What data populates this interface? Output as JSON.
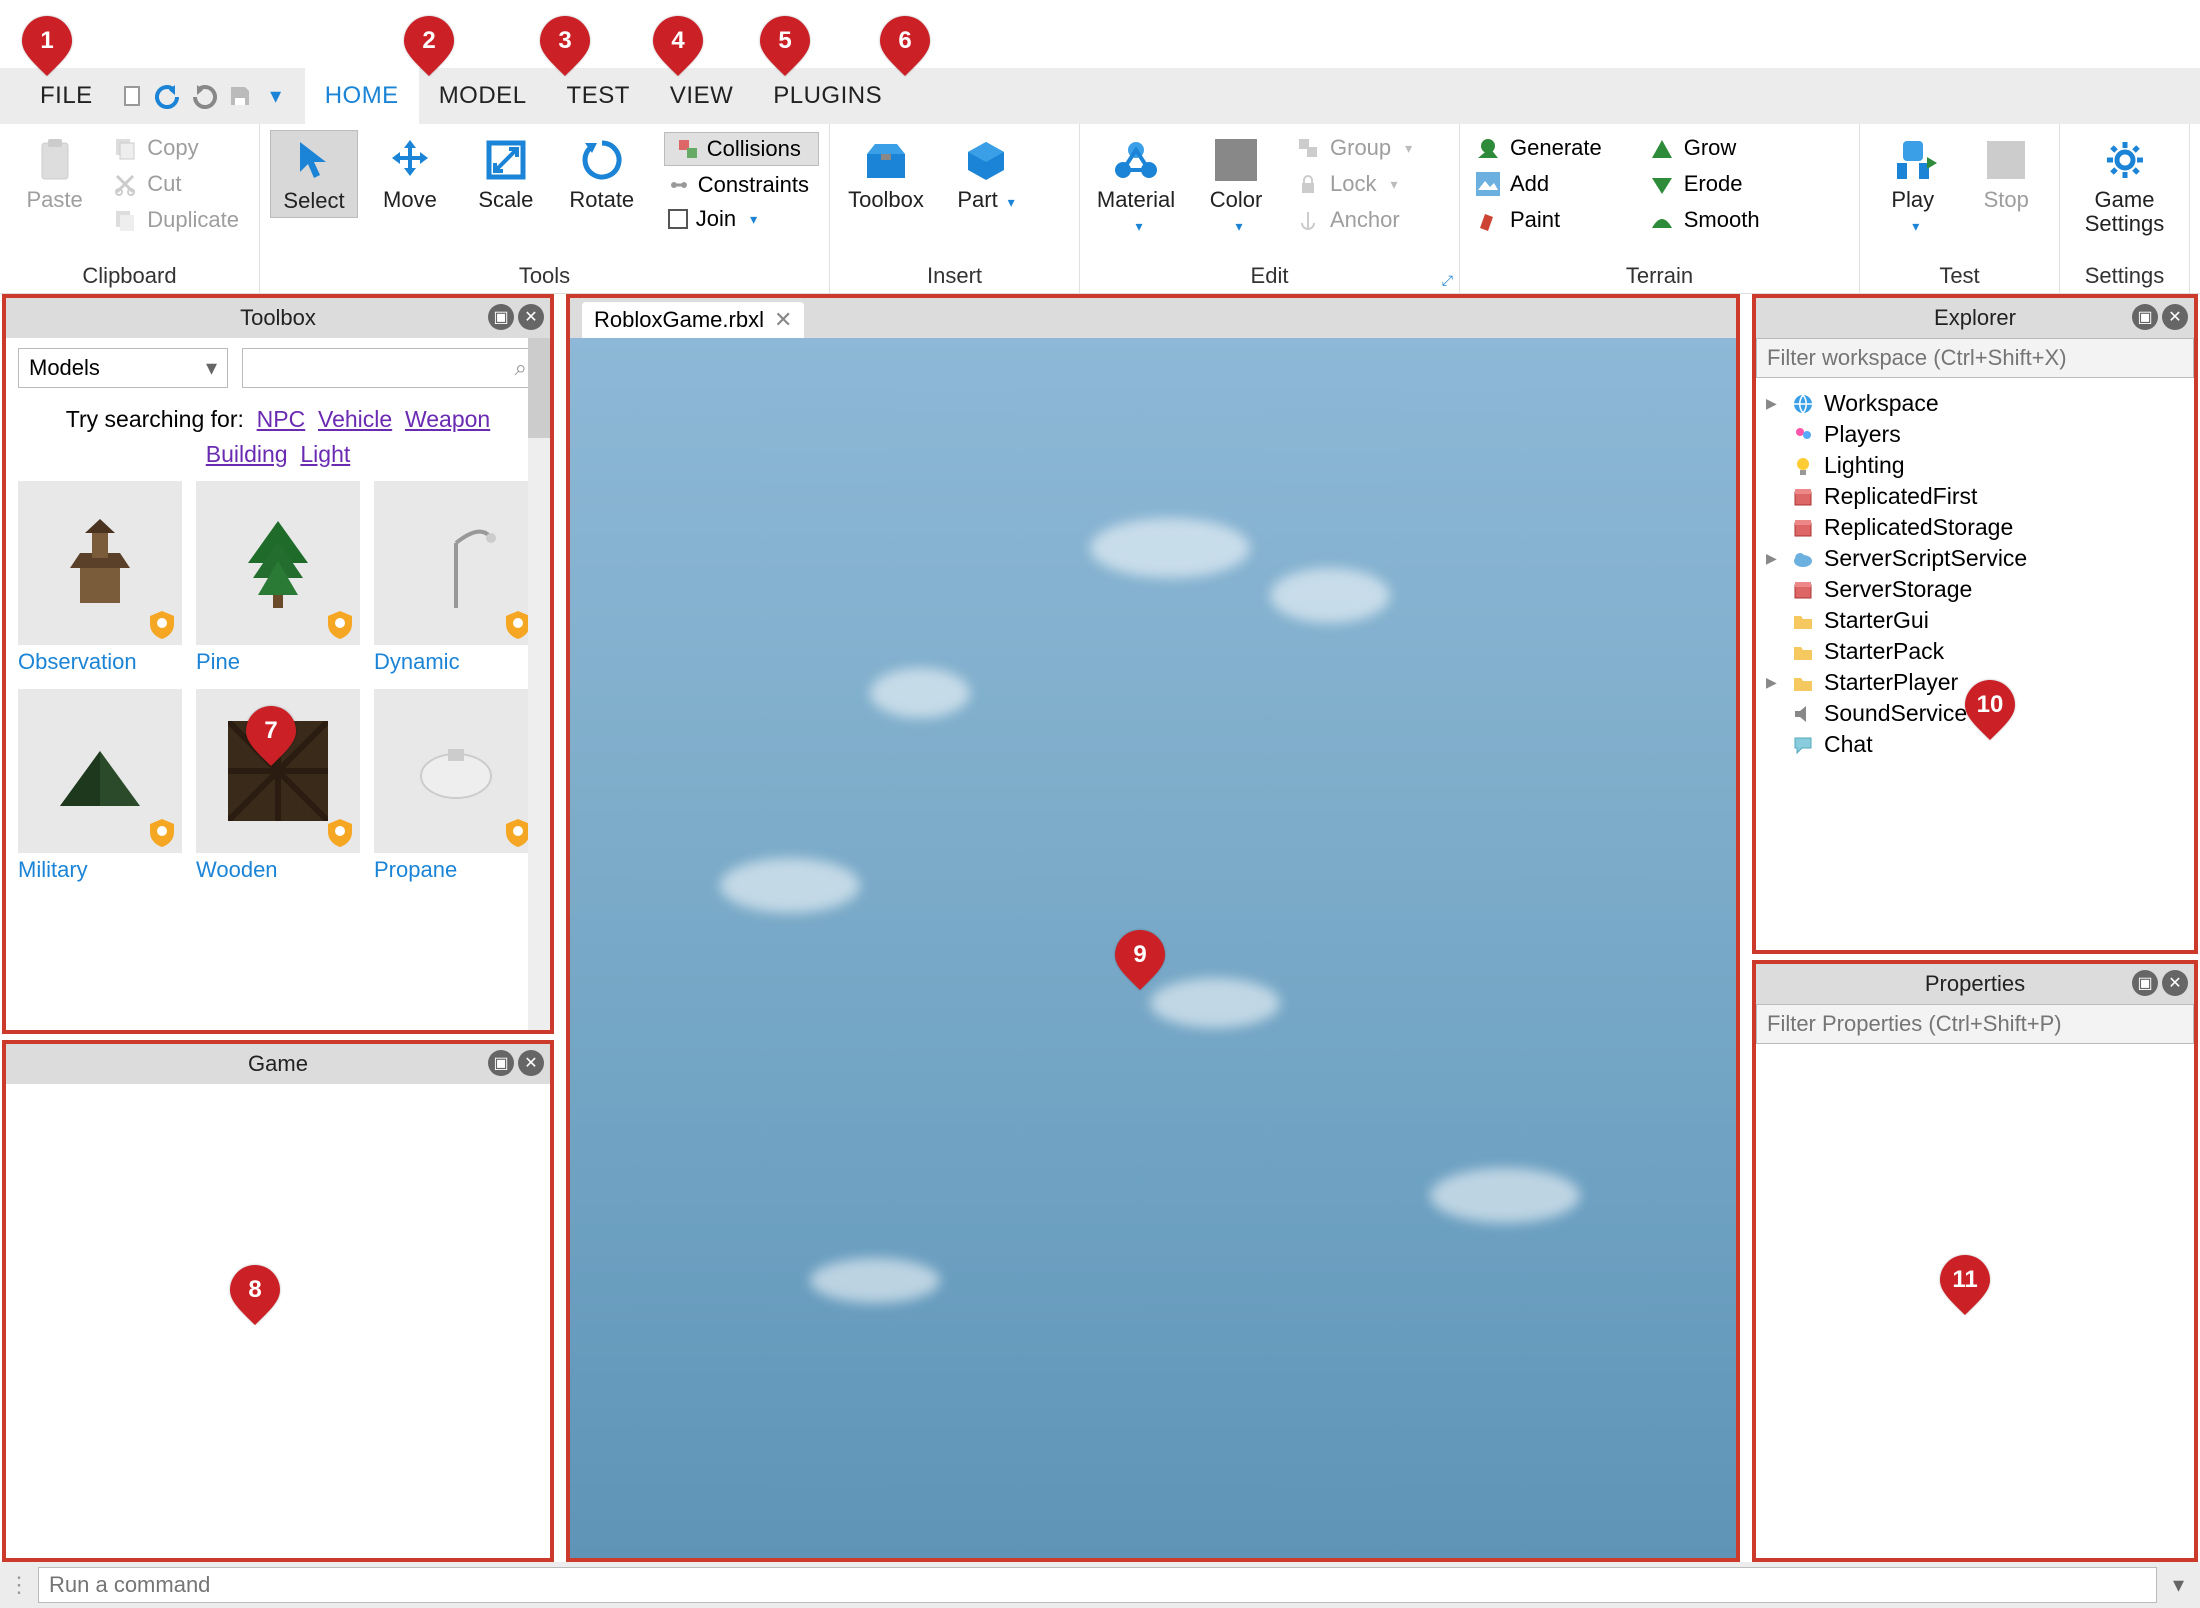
{
  "menubar": {
    "items": [
      "FILE",
      "HOME",
      "MODEL",
      "TEST",
      "VIEW",
      "PLUGINS"
    ],
    "active_index": 1,
    "qa": [
      "new-file-icon",
      "undo-icon",
      "redo-icon",
      "save-icon",
      "menu-icon"
    ]
  },
  "ribbon": {
    "clipboard": {
      "label": "Clipboard",
      "paste": "Paste",
      "copy": "Copy",
      "cut": "Cut",
      "duplicate": "Duplicate"
    },
    "tools": {
      "label": "Tools",
      "buttons": [
        "Select",
        "Move",
        "Scale",
        "Rotate"
      ],
      "collisions": "Collisions",
      "constraints": "Constraints",
      "join": "Join"
    },
    "insert": {
      "label": "Insert",
      "toolbox": "Toolbox",
      "part": "Part"
    },
    "edit": {
      "label": "Edit",
      "material": "Material",
      "color": "Color",
      "group": "Group",
      "lock": "Lock",
      "anchor": "Anchor"
    },
    "terrain": {
      "label": "Terrain",
      "col1": [
        "Generate",
        "Add",
        "Paint"
      ],
      "col2": [
        "Grow",
        "Erode",
        "Smooth"
      ]
    },
    "test": {
      "label": "Test",
      "play": "Play",
      "stop": "Stop"
    },
    "settings": {
      "label": "Settings",
      "game_settings": "Game\nSettings"
    }
  },
  "toolbox": {
    "title": "Toolbox",
    "category": "Models",
    "suggest_prefix": "Try searching for:",
    "suggest_links": [
      "NPC",
      "Vehicle",
      "Weapon",
      "Building",
      "Light"
    ],
    "items": [
      {
        "label": "Observation",
        "thumb": "tower"
      },
      {
        "label": "Pine",
        "thumb": "tree"
      },
      {
        "label": "Dynamic",
        "thumb": "lamp"
      },
      {
        "label": "Military",
        "thumb": "tent"
      },
      {
        "label": "Wooden",
        "thumb": "floor"
      },
      {
        "label": "Propane",
        "thumb": "tank"
      }
    ]
  },
  "game_panel": {
    "title": "Game"
  },
  "document": {
    "tab_name": "RobloxGame.rbxl"
  },
  "explorer": {
    "title": "Explorer",
    "filter_placeholder": "Filter workspace (Ctrl+Shift+X)",
    "tree": [
      {
        "label": "Workspace",
        "icon": "globe",
        "expandable": true
      },
      {
        "label": "Players",
        "icon": "players"
      },
      {
        "label": "Lighting",
        "icon": "bulb"
      },
      {
        "label": "ReplicatedFirst",
        "icon": "box"
      },
      {
        "label": "ReplicatedStorage",
        "icon": "box"
      },
      {
        "label": "ServerScriptService",
        "icon": "cloud",
        "expandable": true
      },
      {
        "label": "ServerStorage",
        "icon": "box"
      },
      {
        "label": "StarterGui",
        "icon": "folder"
      },
      {
        "label": "StarterPack",
        "icon": "folder"
      },
      {
        "label": "StarterPlayer",
        "icon": "folder",
        "expandable": true
      },
      {
        "label": "SoundService",
        "icon": "speaker"
      },
      {
        "label": "Chat",
        "icon": "chat"
      }
    ]
  },
  "properties": {
    "title": "Properties",
    "filter_placeholder": "Filter Properties (Ctrl+Shift+P)"
  },
  "commandbar": {
    "placeholder": "Run a command"
  },
  "callouts": [
    "1",
    "2",
    "3",
    "4",
    "5",
    "6",
    "7",
    "8",
    "9",
    "10",
    "11"
  ]
}
